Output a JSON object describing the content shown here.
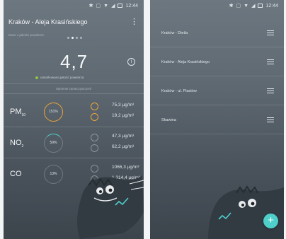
{
  "screen1": {
    "status_time": "12:44",
    "title": "Kraków - Aleja Krasińskiego",
    "subtitle": "Dane z jakości powietrza",
    "caqi_value": "4,7",
    "caqi_note": "umiarkowana jakość powietrza",
    "table_header": "Stężenie zanieczyszczeń",
    "pollutants": [
      {
        "name": "PM",
        "sub": "10",
        "percent": "151%",
        "value1": "75,3 µg/m³",
        "value2": "19,2 µg/m³"
      },
      {
        "name": "NO",
        "sub": "2",
        "percent": "59%",
        "value1": "47,3 µg/m³",
        "value2": "62,2 µg/m³"
      },
      {
        "name": "CO",
        "sub": "",
        "percent": "13%",
        "value1": "1066,3 µg/m³",
        "value2": "1 314,4 µg/m³"
      }
    ],
    "accent": "#e9a43a"
  },
  "screen2": {
    "status_time": "12:44",
    "cities": [
      {
        "name": "Kraków - Dietla"
      },
      {
        "name": "Kraków - Aleja Krasińskiego"
      },
      {
        "name": "Kraków - ul. Piastów"
      },
      {
        "name": "Skawina"
      }
    ],
    "fab_label": "+",
    "fab_color": "#4ecfca"
  }
}
